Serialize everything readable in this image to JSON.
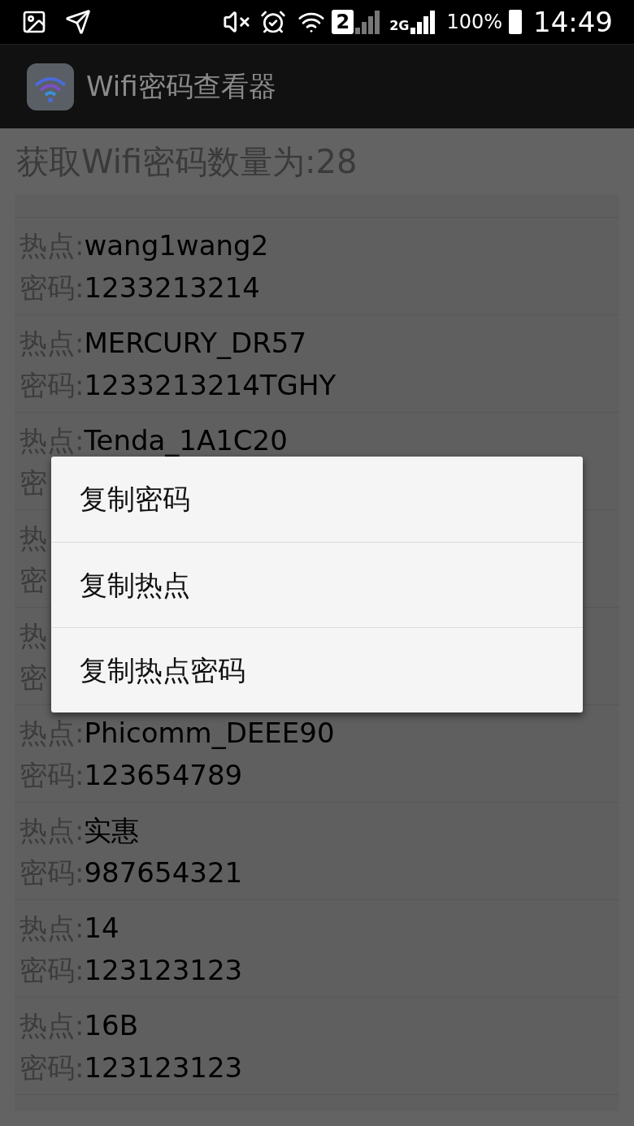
{
  "status_bar": {
    "sim_slot": "2",
    "network": "2G",
    "battery": "100%",
    "time": "14:49"
  },
  "app_bar": {
    "title": "Wifi密码查看器"
  },
  "header": "获取Wifi密码数量为:28",
  "rows": [
    {
      "hotspot_label": "热点:",
      "hotspot": "wang1wang2",
      "password_label": "密码:",
      "password": "1233213214"
    },
    {
      "hotspot_label": "热点:",
      "hotspot": "MERCURY_DR57",
      "password_label": "密码:",
      "password": "1233213214TGHY"
    },
    {
      "hotspot_label": "热点:",
      "hotspot": "Tenda_1A1C20",
      "password_label": "密"
    },
    {
      "hotspot_label": "热",
      "password_label": "密"
    },
    {
      "hotspot_label": "热",
      "password_label": "密"
    },
    {
      "hotspot_label": "热点:",
      "hotspot": "Phicomm_DEEE90",
      "password_label": "密码:",
      "password": "123654789"
    },
    {
      "hotspot_label": "热点:",
      "hotspot": "实惠",
      "password_label": "密码:",
      "password": "987654321"
    },
    {
      "hotspot_label": "热点:",
      "hotspot": "14",
      "password_label": "密码:",
      "password": "123123123"
    },
    {
      "hotspot_label": "热点:",
      "hotspot": "16B",
      "password_label": "密码:",
      "password": "123123123"
    }
  ],
  "menu": {
    "items": [
      {
        "label": "复制密码"
      },
      {
        "label": "复制热点"
      },
      {
        "label": "复制热点密码"
      }
    ]
  }
}
